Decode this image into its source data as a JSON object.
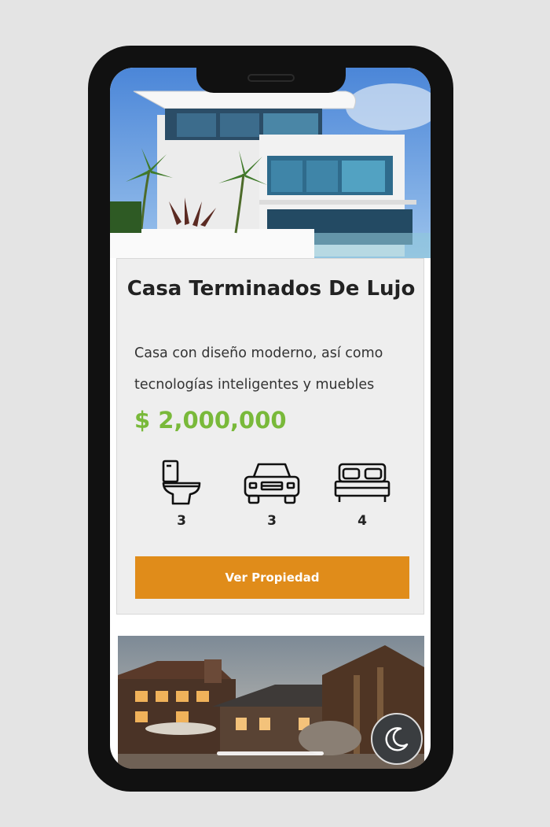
{
  "listing": {
    "title": "Casa Terminados De Lujo",
    "description": "Casa con diseño moderno, así como tecnologías inteligentes y muebles",
    "price": "$ 2,000,000",
    "features": [
      {
        "icon": "toilet-icon",
        "value": "3"
      },
      {
        "icon": "car-icon",
        "value": "3"
      },
      {
        "icon": "bed-icon",
        "value": "4"
      }
    ],
    "button_label": "Ver Propiedad"
  },
  "theme_toggle": {
    "icon": "moon-icon"
  },
  "colors": {
    "accent": "#e08c1a",
    "price": "#79b93a"
  }
}
